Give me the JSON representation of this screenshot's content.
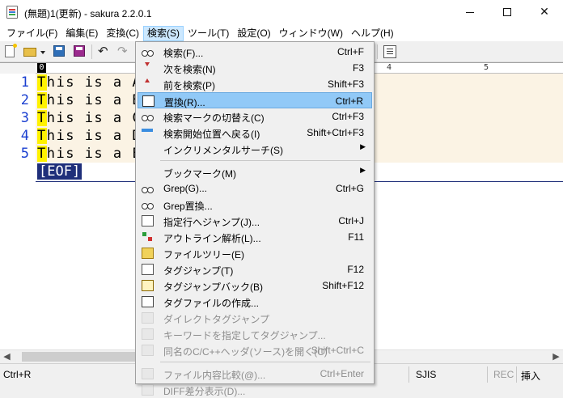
{
  "window": {
    "title": "(無題)1(更新) - sakura 2.2.0.1",
    "minimize_glyph": "—",
    "maximize_glyph": "☐",
    "close_glyph": "✕"
  },
  "menubar": [
    {
      "label": "ファイル(F)",
      "active": false
    },
    {
      "label": "編集(E)",
      "active": false
    },
    {
      "label": "変換(C)",
      "active": false
    },
    {
      "label": "検索(S)",
      "active": true
    },
    {
      "label": "ツール(T)",
      "active": false
    },
    {
      "label": "設定(O)",
      "active": false
    },
    {
      "label": "ウィンドウ(W)",
      "active": false
    },
    {
      "label": "ヘルプ(H)",
      "active": false
    }
  ],
  "toolbar": {
    "icons": [
      "new-document-icon",
      "open-folder-icon",
      "save-icon",
      "save-all-icon",
      "undo-icon",
      "redo-icon",
      "outline-icon"
    ]
  },
  "ruler": {
    "zero": "0",
    "marks": [
      "4",
      "5"
    ]
  },
  "editor": {
    "lines": [
      {
        "number": "1",
        "first": "T",
        "rest": "his is a A"
      },
      {
        "number": "2",
        "first": "T",
        "rest": "his is a B"
      },
      {
        "number": "3",
        "first": "T",
        "rest": "his is a C"
      },
      {
        "number": "4",
        "first": "T",
        "rest": "his is a D"
      },
      {
        "number": "5",
        "first": "T",
        "rest": "his is a E"
      }
    ],
    "eof": "[EOF]",
    "colors": {
      "line_number": "#1a3fd0",
      "cursor_highlight": "#fff200",
      "eof_bg": "#1f2f7a",
      "text_bg": "#fbf3e4"
    }
  },
  "statusbar": {
    "hint": "Ctrl+R",
    "encoding": "SJIS",
    "rec": "REC",
    "mode": "挿入"
  },
  "search_menu": {
    "items": [
      {
        "label": "検索(F)...",
        "shortcut": "Ctrl+F",
        "icon": "search-icon"
      },
      {
        "label": "次を検索(N)",
        "shortcut": "F3",
        "icon": "search-next-icon"
      },
      {
        "label": "前を検索(P)",
        "shortcut": "Shift+F3",
        "icon": "search-prev-icon"
      },
      {
        "label": "置換(R)...",
        "shortcut": "Ctrl+R",
        "icon": "replace-icon",
        "hover": true
      },
      {
        "label": "検索マークの切替え(C)",
        "shortcut": "Ctrl+F3",
        "icon": "search-mark-icon"
      },
      {
        "label": "検索開始位置へ戻る(I)",
        "shortcut": "Shift+Ctrl+F3",
        "icon": "search-start-icon"
      },
      {
        "label": "インクリメンタルサーチ(S)",
        "shortcut": "",
        "icon": "",
        "submenu": true
      },
      {
        "separator": true
      },
      {
        "label": "ブックマーク(M)",
        "shortcut": "",
        "icon": "",
        "submenu": true
      },
      {
        "label": "Grep(G)...",
        "shortcut": "Ctrl+G",
        "icon": "grep-icon"
      },
      {
        "label": "Grep置換...",
        "shortcut": "",
        "icon": "grep-replace-icon"
      },
      {
        "label": "指定行へジャンプ(J)...",
        "shortcut": "Ctrl+J",
        "icon": "jump-icon"
      },
      {
        "label": "アウトライン解析(L)...",
        "shortcut": "F11",
        "icon": "outline-icon"
      },
      {
        "label": "ファイルツリー(E)",
        "shortcut": "",
        "icon": "file-tree-icon"
      },
      {
        "label": "タグジャンプ(T)",
        "shortcut": "F12",
        "icon": "tag-jump-icon"
      },
      {
        "label": "タグジャンプバック(B)",
        "shortcut": "Shift+F12",
        "icon": "tag-jump-back-icon"
      },
      {
        "label": "タグファイルの作成...",
        "shortcut": "",
        "icon": "tag-file-icon"
      },
      {
        "label": "ダイレクトタグジャンプ",
        "shortcut": "",
        "icon": "direct-tag-jump-icon",
        "disabled": true
      },
      {
        "label": "キーワードを指定してタグジャンプ...",
        "shortcut": "",
        "icon": "keyword-tag-jump-icon",
        "disabled": true
      },
      {
        "label": "同名のC/C++ヘッダ(ソース)を開く(C)",
        "shortcut": "Shift+Ctrl+C",
        "icon": "open-header-icon",
        "disabled": true
      },
      {
        "separator": true
      },
      {
        "label": "ファイル内容比較(@)...",
        "shortcut": "Ctrl+Enter",
        "icon": "compare-icon",
        "disabled": true
      },
      {
        "label": "DIFF差分表示(D)...",
        "shortcut": "",
        "icon": "diff-icon",
        "disabled": true
      }
    ]
  }
}
